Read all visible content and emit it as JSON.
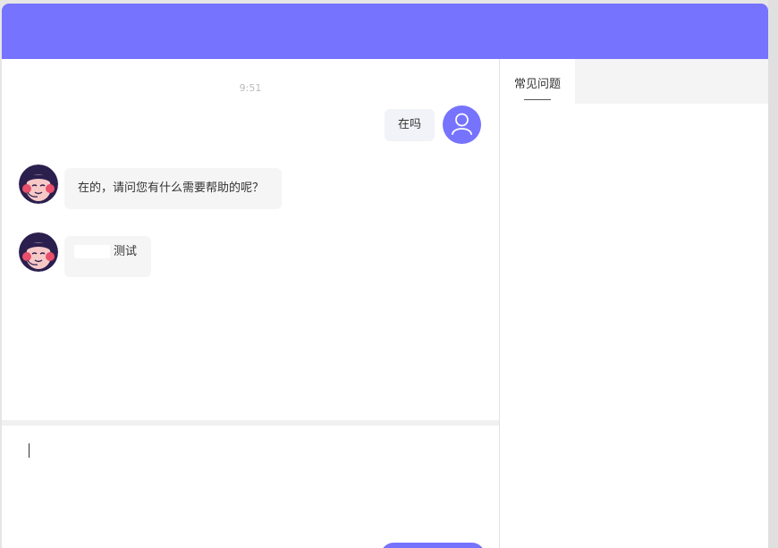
{
  "chat": {
    "timestamp": "9:51",
    "messages": [
      {
        "from": "user",
        "text": "在吗"
      },
      {
        "from": "agent",
        "text": "在的，请问您有什么需要帮助的呢？"
      },
      {
        "from": "agent",
        "text": "测试"
      }
    ]
  },
  "side_panel": {
    "tabs": [
      {
        "label": "常见问题",
        "active": true
      }
    ]
  },
  "colors": {
    "accent": "#7673ff",
    "bubble_user": "#f1f3f8",
    "bubble_agent": "#f5f5f5"
  },
  "icons": {
    "user_avatar": "user-avatar-icon",
    "agent_avatar": "agent-avatar-icon"
  }
}
